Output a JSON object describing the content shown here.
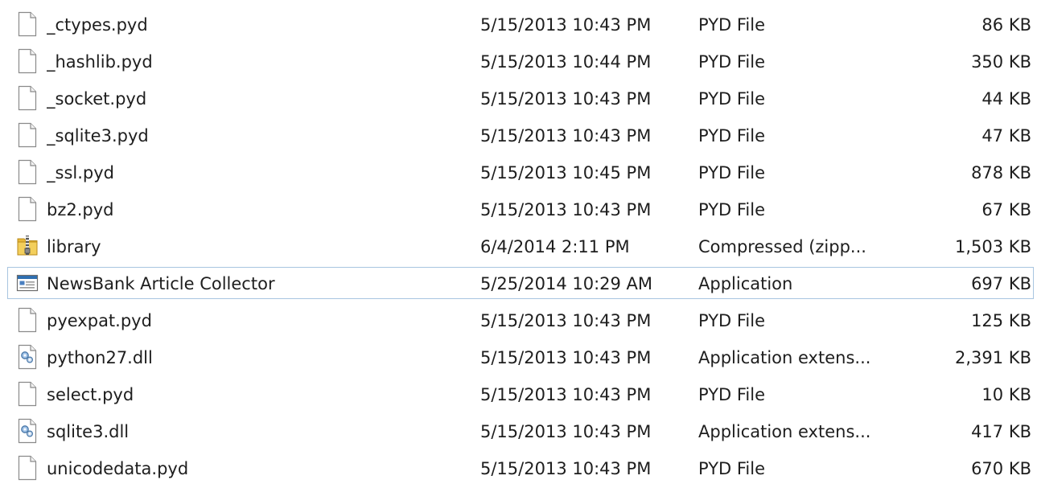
{
  "files": [
    {
      "name": "_ctypes.pyd",
      "date": "5/15/2013 10:43 PM",
      "type": "PYD File",
      "size": "86 KB",
      "icon": "file-icon"
    },
    {
      "name": "_hashlib.pyd",
      "date": "5/15/2013 10:44 PM",
      "type": "PYD File",
      "size": "350 KB",
      "icon": "file-icon"
    },
    {
      "name": "_socket.pyd",
      "date": "5/15/2013 10:43 PM",
      "type": "PYD File",
      "size": "44 KB",
      "icon": "file-icon"
    },
    {
      "name": "_sqlite3.pyd",
      "date": "5/15/2013 10:43 PM",
      "type": "PYD File",
      "size": "47 KB",
      "icon": "file-icon"
    },
    {
      "name": "_ssl.pyd",
      "date": "5/15/2013 10:45 PM",
      "type": "PYD File",
      "size": "878 KB",
      "icon": "file-icon"
    },
    {
      "name": "bz2.pyd",
      "date": "5/15/2013 10:43 PM",
      "type": "PYD File",
      "size": "67 KB",
      "icon": "file-icon"
    },
    {
      "name": "library",
      "date": "6/4/2014 2:11 PM",
      "type": "Compressed (zipp...",
      "size": "1,503 KB",
      "icon": "zip-folder-icon"
    },
    {
      "name": "NewsBank Article Collector",
      "date": "5/25/2014 10:29 AM",
      "type": "Application",
      "size": "697 KB",
      "icon": "application-icon"
    },
    {
      "name": "pyexpat.pyd",
      "date": "5/15/2013 10:43 PM",
      "type": "PYD File",
      "size": "125 KB",
      "icon": "file-icon"
    },
    {
      "name": "python27.dll",
      "date": "5/15/2013 10:43 PM",
      "type": "Application extens...",
      "size": "2,391 KB",
      "icon": "dll-icon"
    },
    {
      "name": "select.pyd",
      "date": "5/15/2013 10:43 PM",
      "type": "PYD File",
      "size": "10 KB",
      "icon": "file-icon"
    },
    {
      "name": "sqlite3.dll",
      "date": "5/15/2013 10:43 PM",
      "type": "Application extens...",
      "size": "417 KB",
      "icon": "dll-icon"
    },
    {
      "name": "unicodedata.pyd",
      "date": "5/15/2013 10:43 PM",
      "type": "PYD File",
      "size": "670 KB",
      "icon": "file-icon"
    }
  ],
  "focused_file": "NewsBank Article Collector",
  "colors": {
    "text": "#1e1e1e",
    "focus_border": "#a8c5e0",
    "folder_yellow": "#e8b839",
    "app_blue": "#2f6fb0"
  }
}
